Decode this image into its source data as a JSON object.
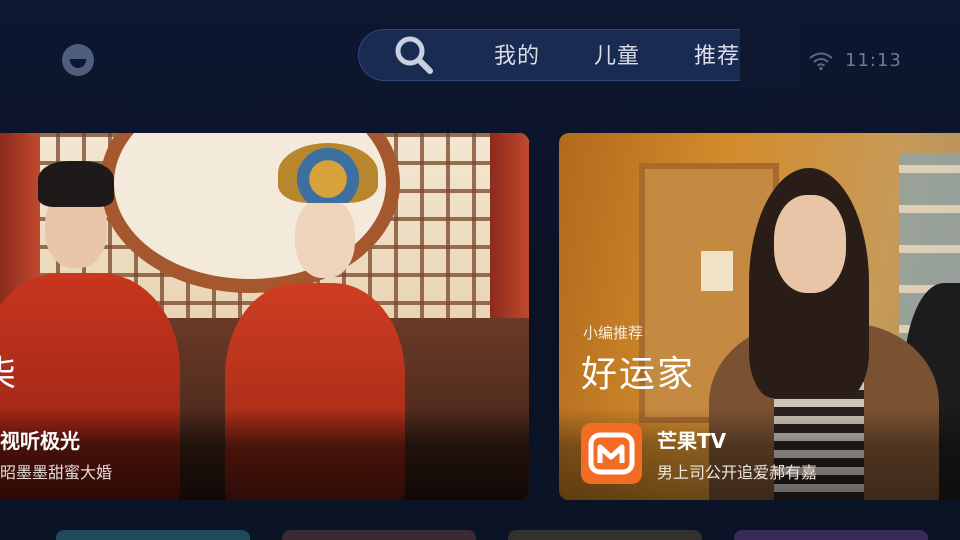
{
  "nav": {
    "tabs": [
      "我的",
      "儿童",
      "推荐"
    ]
  },
  "status": {
    "time": "11:13"
  },
  "cards": {
    "left": {
      "big_text": "柒",
      "title": "视听极光",
      "subtitle": "昭墨墨甜蜜大婚"
    },
    "right": {
      "badge": "小编推荐",
      "title": "好运家",
      "app": "芒果TV",
      "subtitle": "男上司公开追爱郝有嘉"
    }
  },
  "colors": {
    "background": "#0b1326",
    "nav_pill": "#1a2b52",
    "mango_orange": "#f36c24"
  }
}
